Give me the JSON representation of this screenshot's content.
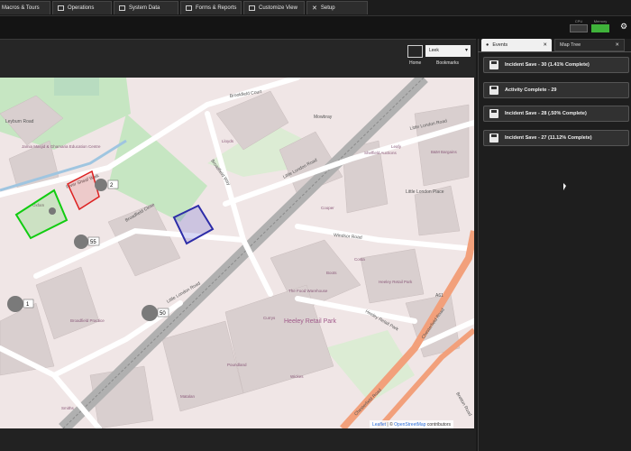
{
  "top_tabs": [
    {
      "label": "Macros & Tours",
      "icon": "macro-icon"
    },
    {
      "label": "Operations",
      "icon": "operations-icon"
    },
    {
      "label": "System Data",
      "icon": "system-data-icon"
    },
    {
      "label": "Forms & Reports",
      "icon": "forms-icon"
    },
    {
      "label": "Customize View",
      "icon": "customize-icon"
    },
    {
      "label": "Setup",
      "icon": "setup-icon"
    }
  ],
  "status": {
    "cpu_label": "CPU",
    "memory_label": "Memory"
  },
  "map_toolbar": {
    "home_label": "Home",
    "bookmarks_label": "Bookmarks",
    "site_select": "Leek"
  },
  "attribution": {
    "leaflet": "Leaflet",
    "separator": " | © ",
    "osm": "OpenStreetMap",
    "suffix": " contributors"
  },
  "right_panel": {
    "tabs": [
      {
        "label": "Events",
        "active": true
      },
      {
        "label": "Map Tree",
        "active": false
      }
    ],
    "events": [
      {
        "text": "Incident Save - 30 (1.41% Complete)"
      },
      {
        "text": "Activity Complete - 29"
      },
      {
        "text": "Incident Save - 28 (.50% Complete)"
      },
      {
        "text": "Incident Save - 27 (11.12% Complete)"
      }
    ]
  },
  "map": {
    "streets": [
      "Brookfield Court",
      "Little London Road",
      "Little London Road",
      "Windsor Road",
      "Chesterfield Road",
      "Broadfield Close",
      "Heeley Retail Park",
      "Little London Place",
      "Mowbray",
      "Chesterfield Road",
      "A61",
      "Broadfield Way",
      "River Sheaf Walk",
      "Heeley Retail Park",
      "Bretton Road",
      "Leyburn Road",
      "Little London Road"
    ],
    "places": [
      "Jamia Masjid & Ghamaria Education Centre",
      "Sheffield Auctions",
      "B&M Bargains",
      "The Food Warehouse",
      "Currys",
      "Boots",
      "Costa",
      "Poundland",
      "Matalan",
      "Broadfield Practice",
      "Wickes",
      "Smiths",
      "Cooper",
      "Heeley Retail Park",
      "Leafy",
      "Lloyds",
      "Oxfam"
    ],
    "markers": [
      {
        "count": "2"
      },
      {
        "count": "55"
      },
      {
        "count": "1"
      },
      {
        "count": "50"
      }
    ]
  }
}
